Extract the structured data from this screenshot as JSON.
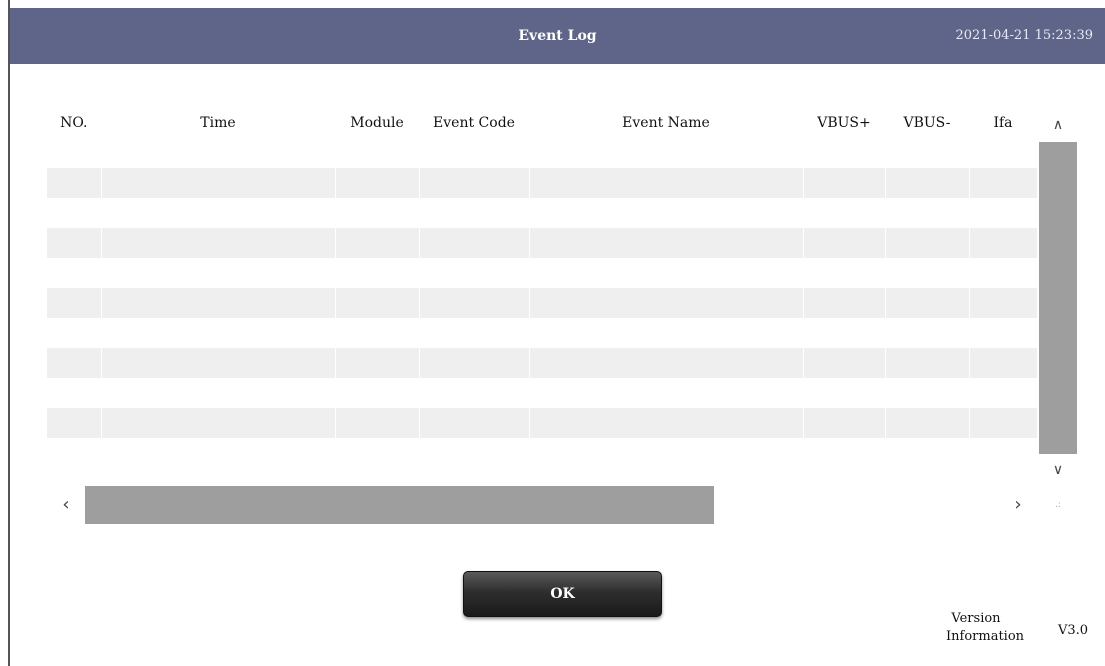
{
  "header": {
    "title": "Event Log",
    "datetime": "2021-04-21 15:23:39",
    "background": "#5f6588"
  },
  "table": {
    "columns": [
      "NO.",
      "Time",
      "Module",
      "Event Code",
      "Event Name",
      "VBUS+",
      "VBUS-",
      "Ifa"
    ],
    "empty_row_count": 11
  },
  "scrollbars": {
    "vertical": {
      "up_glyph": "∧",
      "down_glyph": "∨"
    },
    "horizontal": {
      "left_glyph": "‹",
      "right_glyph": "›"
    },
    "grip_glyph": ".:"
  },
  "actions": {
    "ok_label": "OK"
  },
  "version": {
    "label_line1": "Version",
    "label_line2": "Information",
    "value": "V3.0"
  }
}
